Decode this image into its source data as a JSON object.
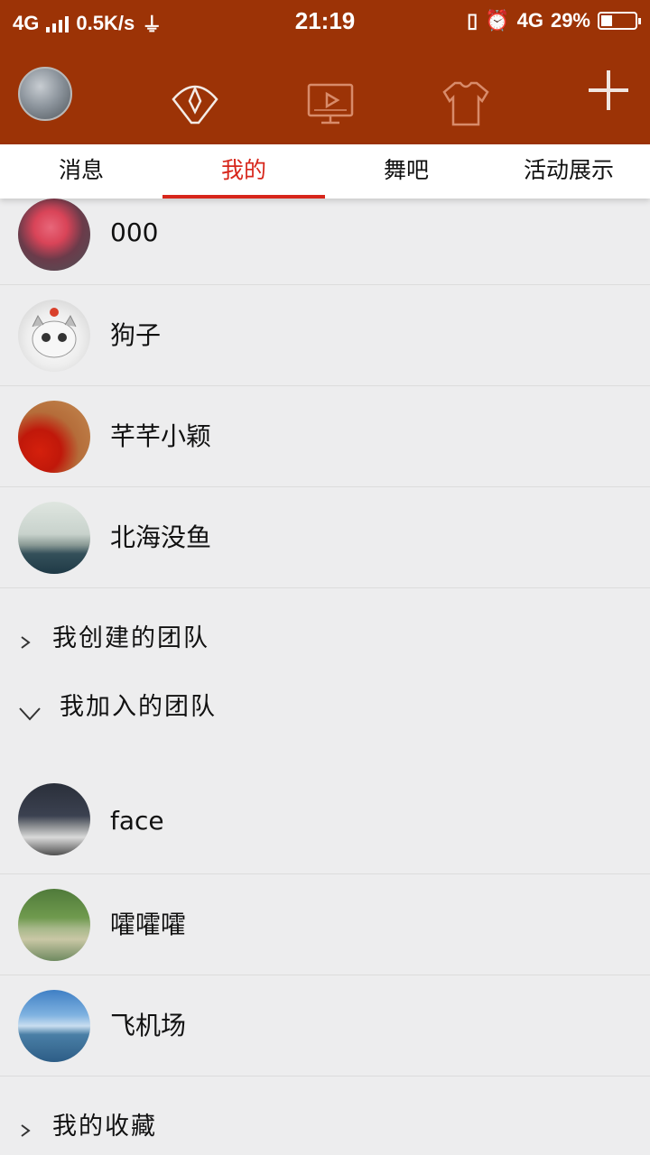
{
  "status_bar": {
    "network_left": "4G",
    "speed": "0.5K/s",
    "time": "21:19",
    "network_right": "4G",
    "battery": "29%",
    "battery_level": 0.29
  },
  "app_bar": {
    "icons": [
      "fan-icon",
      "video-player-icon",
      "costume-shirt-icon",
      "plus-icon"
    ]
  },
  "tabs": [
    {
      "label": "消息",
      "active": false
    },
    {
      "label": "我的",
      "active": true
    },
    {
      "label": "舞吧",
      "active": false
    },
    {
      "label": "活动展示",
      "active": false
    }
  ],
  "friends": [
    {
      "name": "000"
    },
    {
      "name": "狗子"
    },
    {
      "name": "芊芊小颖"
    },
    {
      "name": "北海没鱼"
    }
  ],
  "sections": {
    "created_teams": "我创建的团队",
    "joined_teams": "我加入的团队",
    "favorites": "我的收藏"
  },
  "joined_teams": [
    {
      "name": "face"
    },
    {
      "name": "嚯嚯嚯"
    },
    {
      "name": "飞机场"
    }
  ],
  "colors": {
    "header": "#9c3306",
    "accent": "#d7261b",
    "background": "#ededee"
  }
}
